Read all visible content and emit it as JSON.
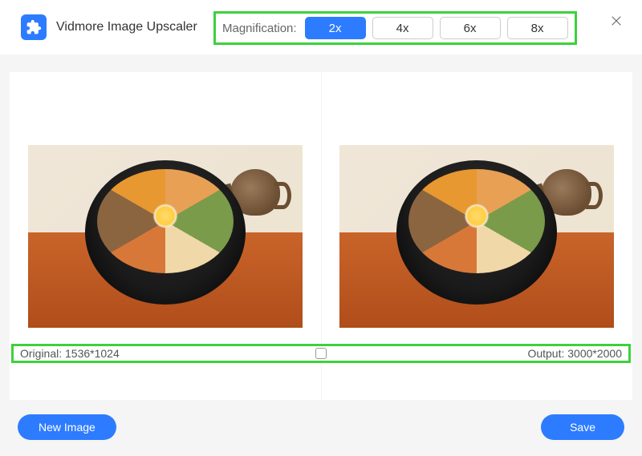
{
  "app": {
    "title": "Vidmore Image Upscaler"
  },
  "magnification": {
    "label": "Magnification:",
    "options": [
      "2x",
      "4x",
      "6x",
      "8x"
    ],
    "selected": "2x"
  },
  "dimensions": {
    "original_label": "Original: 1536*1024",
    "output_label": "Output: 3000*2000"
  },
  "footer": {
    "new_image_label": "New Image",
    "save_label": "Save"
  },
  "icons": {
    "close": "close-icon",
    "logo": "puzzle-icon"
  }
}
